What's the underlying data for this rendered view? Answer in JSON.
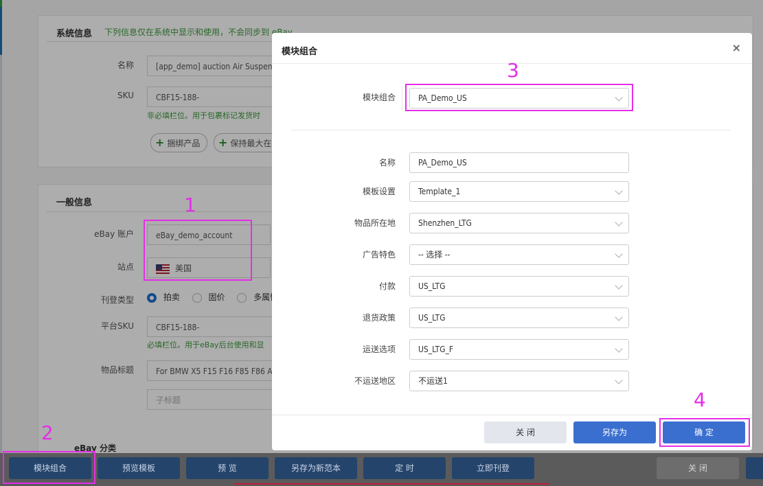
{
  "system_info": {
    "title": "系统信息",
    "note": "下列信息仅在系统中显示和使用，不会同步到 eBay",
    "name_label": "名称",
    "name_value": "[app_demo] auction Air Suspens",
    "sku_label": "SKU",
    "sku_value": "CBF15-188-",
    "sku_hint": "非必填栏位。用于包裹标记发货时",
    "bundle_button": "捆绑产品",
    "keep_button": "保持最大在"
  },
  "general_info": {
    "title": "一般信息",
    "account_label": "eBay 账户",
    "account_value": "eBay_demo_account",
    "site_label": "站点",
    "site_value": "美国",
    "listing_type_label": "刊登类型",
    "listing_types": [
      "拍卖",
      "固价",
      "多属性"
    ],
    "platform_sku_label": "平台SKU",
    "platform_sku_value": "CBF15-188-",
    "platform_sku_hint": "必填栏位。用于eBay后台使用和显",
    "item_title_label": "物品标题",
    "item_title_value": "For BMW X5 F15 F16 F85 F86 A",
    "subtitle_placeholder": "子标题",
    "ebay_category": "eBay 分类"
  },
  "bottom_bar": {
    "module_combo": "模块组合",
    "preview_template": "预览模板",
    "preview": "预 览",
    "save_as_sample": "另存为新范本",
    "schedule": "定 时",
    "list_now": "立即刊登",
    "close": "关 闭"
  },
  "modal": {
    "title": "模块组合",
    "close_icon": "×",
    "combo_label": "模块组合",
    "combo_value": "PA_Demo_US",
    "fields": [
      {
        "label": "名称",
        "value": "PA_Demo_US",
        "type": "input"
      },
      {
        "label": "模板设置",
        "value": "Template_1",
        "type": "select"
      },
      {
        "label": "物品所在地",
        "value": "Shenzhen_LTG",
        "type": "select"
      },
      {
        "label": "广告特色",
        "value": "-- 选择 --",
        "type": "select"
      },
      {
        "label": "付款",
        "value": "US_LTG",
        "type": "select"
      },
      {
        "label": "退货政策",
        "value": "US_LTG",
        "type": "select"
      },
      {
        "label": "运送选项",
        "value": "US_LTG_F",
        "type": "select"
      },
      {
        "label": "不运送地区",
        "value": "不运送1",
        "type": "select"
      }
    ],
    "close_button": "关 闭",
    "save_as_button": "另存为",
    "confirm_button": "确 定"
  },
  "annotations": [
    "1",
    "2",
    "3",
    "4"
  ],
  "colors": {
    "highlight": "#e42ee8",
    "primary": "#3a6fd0",
    "success_text": "#3c9a3c"
  }
}
